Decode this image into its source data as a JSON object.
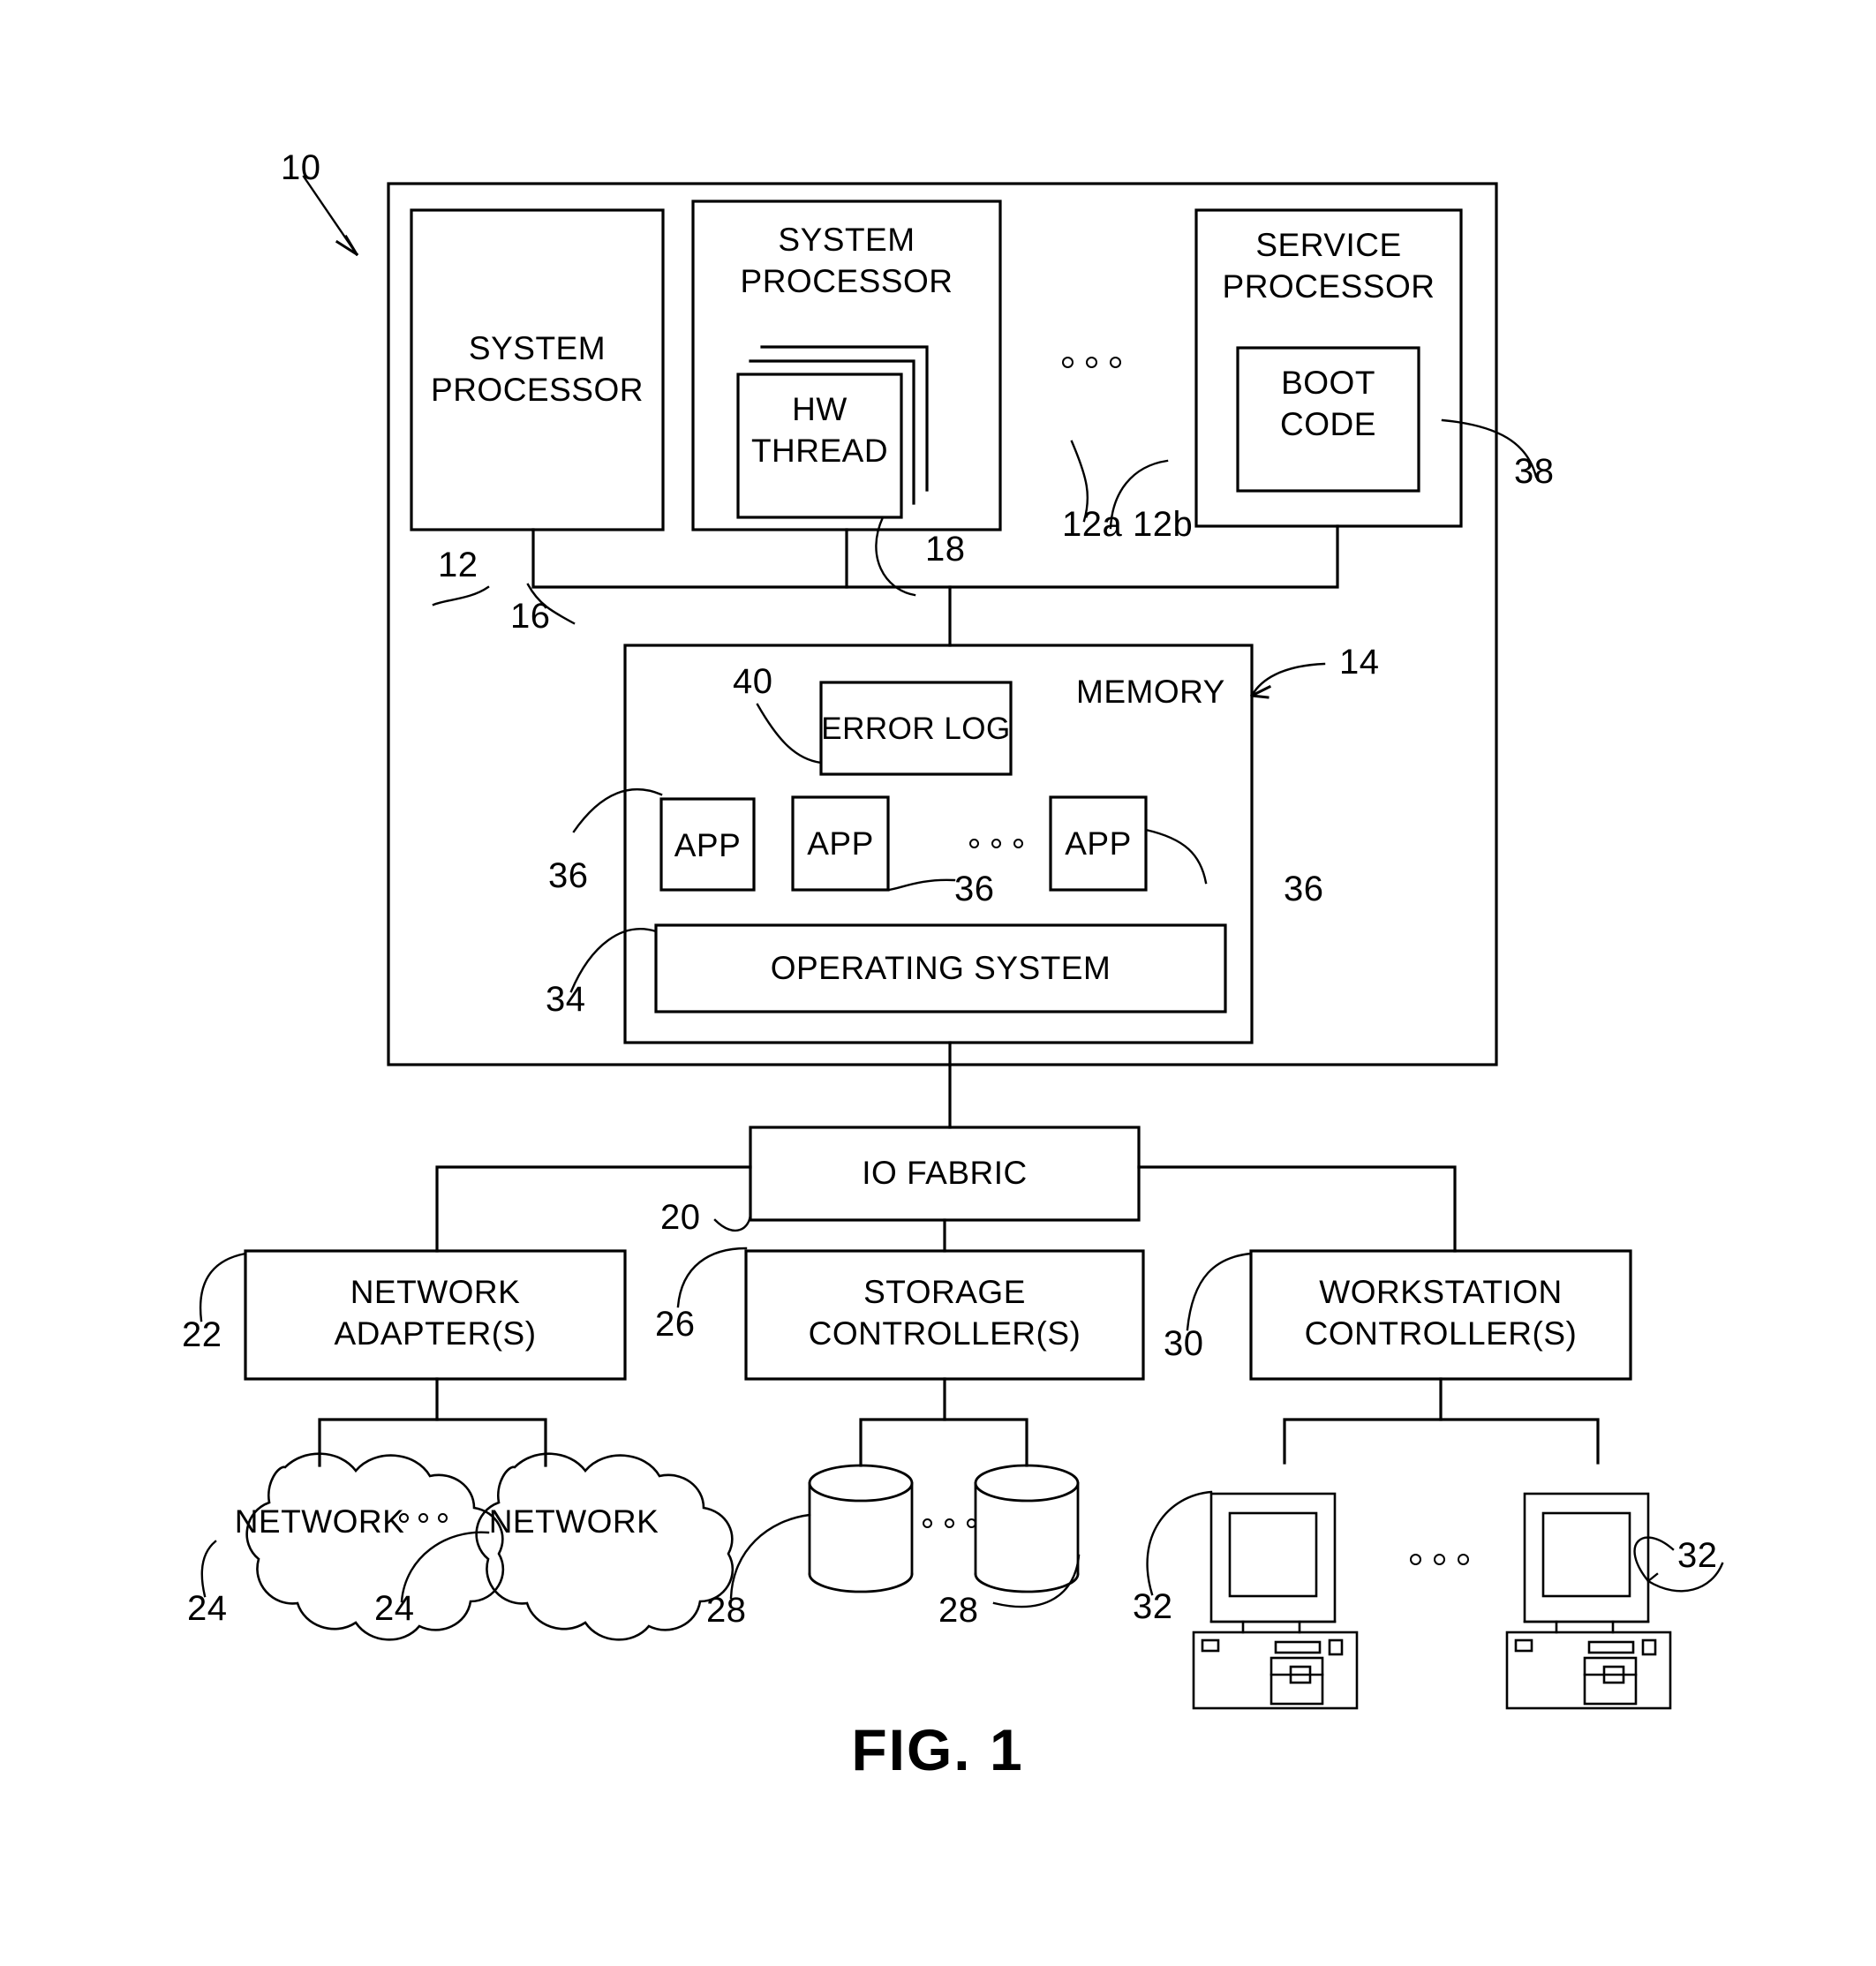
{
  "figure": {
    "caption": "FIG. 1",
    "system_ref": "10"
  },
  "blocks": {
    "system_processor_1": {
      "label": "SYSTEM\nPROCESSOR",
      "ref": "12"
    },
    "system_processor_2": {
      "label": "SYSTEM\nPROCESSOR"
    },
    "hw_thread": {
      "label": "HW\nTHREAD",
      "ref": "18"
    },
    "service_processor": {
      "label": "SERVICE\nPROCESSOR"
    },
    "boot_code": {
      "label": "BOOT\nCODE",
      "ref": "38"
    },
    "bus": {
      "ref": "16"
    },
    "proc_group_a": {
      "ref": "12a"
    },
    "proc_group_b": {
      "ref": "12b"
    },
    "memory": {
      "label": "MEMORY",
      "ref": "14"
    },
    "error_log": {
      "label": "ERROR LOG",
      "ref": "40"
    },
    "app1": {
      "label": "APP",
      "ref": "36"
    },
    "app2": {
      "label": "APP",
      "ref": "36"
    },
    "app3": {
      "label": "APP",
      "ref": "36"
    },
    "operating_system": {
      "label": "OPERATING SYSTEM",
      "ref": "34"
    },
    "io_fabric": {
      "label": "IO FABRIC",
      "ref": "20"
    },
    "network_adapters": {
      "label": "NETWORK\nADAPTER(S)",
      "ref": "22"
    },
    "storage_controllers": {
      "label": "STORAGE\nCONTROLLER(S)",
      "ref": "26"
    },
    "workstation_controllers": {
      "label": "WORKSTATION\nCONTROLLER(S)",
      "ref": "30"
    },
    "network_cloud_1": {
      "label": "NETWORK",
      "ref": "24"
    },
    "network_cloud_2": {
      "label": "NETWORK",
      "ref": "24"
    },
    "storage_disk_1": {
      "ref": "28"
    },
    "storage_disk_2": {
      "ref": "28"
    },
    "workstation_1": {
      "ref": "32"
    },
    "workstation_2": {
      "ref": "32"
    }
  },
  "text": {
    "system_processor_line1": "SYSTEM",
    "system_processor_line2": "PROCESSOR",
    "service_processor_line1": "SERVICE",
    "service_processor_line2": "PROCESSOR",
    "hw_line1": "HW",
    "hw_line2": "THREAD",
    "boot_line1": "BOOT",
    "boot_line2": "CODE",
    "memory": "MEMORY",
    "error_log": "ERROR LOG",
    "app": "APP",
    "operating_system": "OPERATING SYSTEM",
    "io_fabric": "IO FABRIC",
    "net_adapter_line1": "NETWORK",
    "net_adapter_line2": "ADAPTER(S)",
    "storage_ctrl_line1": "STORAGE",
    "storage_ctrl_line2": "CONTROLLER(S)",
    "ws_ctrl_line1": "WORKSTATION",
    "ws_ctrl_line2": "CONTROLLER(S)",
    "network": "NETWORK",
    "fig_caption": "FIG. 1"
  },
  "refs": {
    "r10": "10",
    "r12": "12",
    "r12a": "12a",
    "r12b": "12b",
    "r14": "14",
    "r16": "16",
    "r18": "18",
    "r20": "20",
    "r22": "22",
    "r24a": "24",
    "r24b": "24",
    "r26": "26",
    "r28a": "28",
    "r28b": "28",
    "r30": "30",
    "r32a": "32",
    "r32b": "32",
    "r34": "34",
    "r36a": "36",
    "r36b": "36",
    "r36c": "36",
    "r38": "38",
    "r40": "40"
  },
  "colors": {
    "ink": "#000000",
    "paper": "#ffffff"
  }
}
